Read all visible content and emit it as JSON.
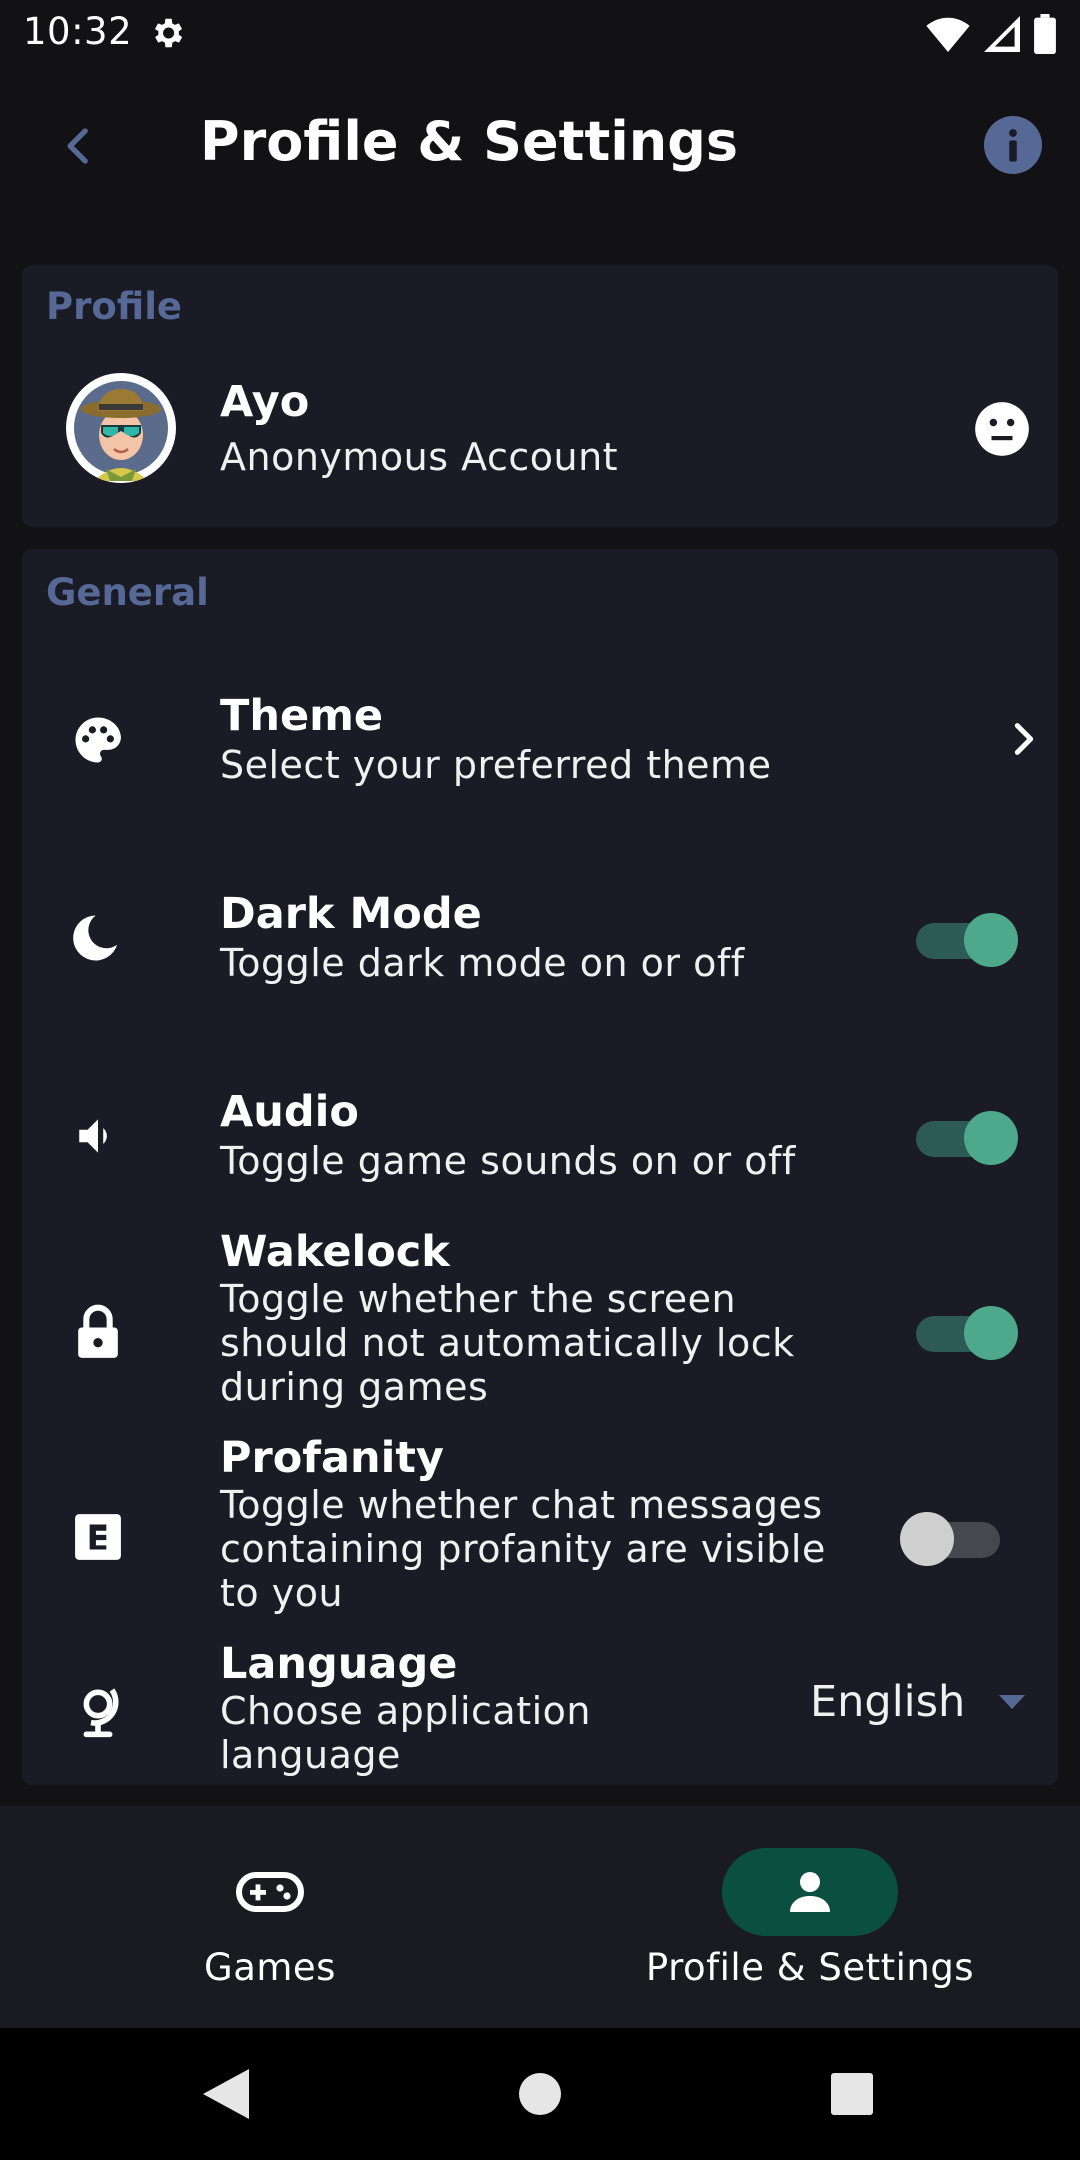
{
  "status_bar": {
    "time": "10:32",
    "icons": [
      "settings-icon",
      "wifi-icon",
      "signal-icon",
      "battery-icon"
    ]
  },
  "app_bar": {
    "title": "Profile & Settings",
    "back_icon": "chevron-left-icon",
    "info_icon": "info-icon"
  },
  "profile": {
    "section_label": "Profile",
    "name": "Ayo",
    "account_type": "Anonymous Account",
    "status_icon": "neutral-face-icon"
  },
  "general": {
    "section_label": "General",
    "theme": {
      "title": "Theme",
      "description": "Select your preferred theme",
      "icon": "palette-icon"
    },
    "dark_mode": {
      "title": "Dark Mode",
      "description": "Toggle dark mode on or off",
      "enabled": true,
      "icon": "moon-icon"
    },
    "audio": {
      "title": "Audio",
      "description": "Toggle game sounds on or off",
      "enabled": true,
      "icon": "speaker-icon"
    },
    "wakelock": {
      "title": "Wakelock",
      "description": "Toggle whether the screen should not automatically lock during games",
      "enabled": true,
      "icon": "lock-icon"
    },
    "profanity": {
      "title": "Profanity",
      "description": "Toggle whether chat messages containing profanity are visible to you",
      "enabled": false,
      "icon": "explicit-icon"
    },
    "language": {
      "title": "Language",
      "description": "Choose application language",
      "selected": "English",
      "icon": "globe-icon"
    }
  },
  "bottom_nav": {
    "games_label": "Games",
    "profile_label": "Profile & Settings",
    "active": "Profile & Settings"
  },
  "colors": {
    "background": "#121214",
    "card": "#1a1b24",
    "section_label": "#566996",
    "toggle_on": "#4ea88c",
    "nav_active": "#0b4f40"
  }
}
